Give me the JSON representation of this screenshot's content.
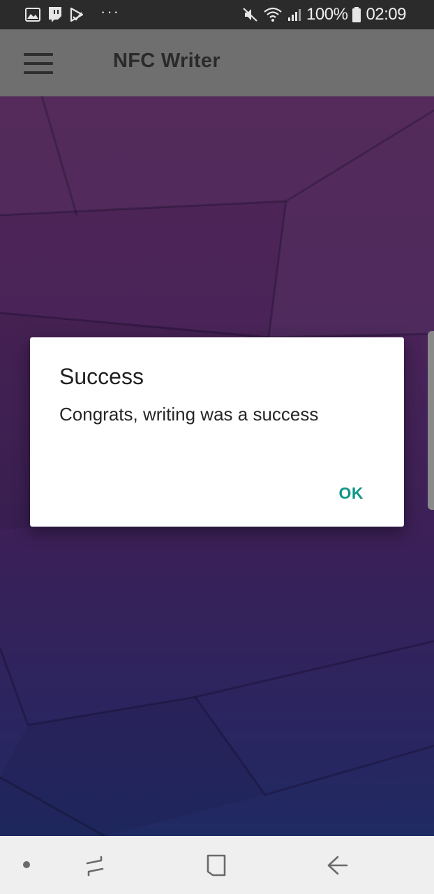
{
  "status_bar": {
    "left_icons": [
      "gallery-icon",
      "twitch-icon",
      "play-store-icon"
    ],
    "dots": "···",
    "right_icons": [
      "mute-icon",
      "wifi-icon",
      "signal-icon"
    ],
    "battery": "100%",
    "time": "02:09"
  },
  "app_bar": {
    "title": "NFC Writer",
    "menu_icon": "hamburger-menu-icon"
  },
  "dialog": {
    "title": "Success",
    "message": "Congrats, writing was a success",
    "ok_label": "OK",
    "accent_color": "#0f9688"
  },
  "nav_bar": {
    "icons": [
      "dot-indicator",
      "recent-apps-icon",
      "home-icon",
      "back-icon"
    ]
  },
  "colors": {
    "status_bar_bg": "#2b2b2b",
    "app_bar_bg": "#6f6f6f",
    "background_top": "#4f2555",
    "background_bottom": "#202a62",
    "nav_bar_bg": "#efefef"
  }
}
